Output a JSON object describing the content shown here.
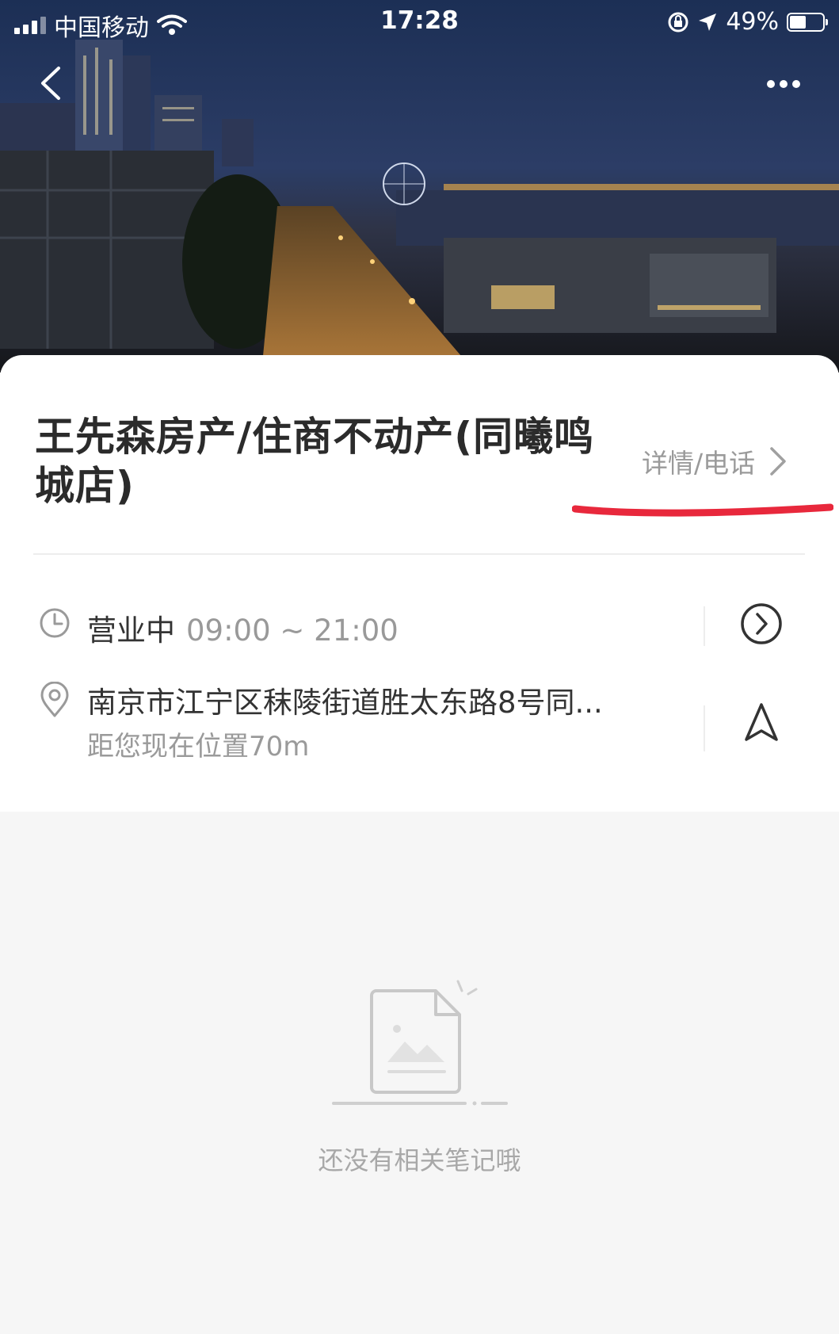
{
  "status_bar": {
    "carrier": "中国移动",
    "time": "17:28",
    "battery": "49%",
    "battery_level": 0.49,
    "icons": [
      "signal-icon",
      "wifi-icon",
      "rotation-lock-icon",
      "location-arrow-icon",
      "battery-icon"
    ]
  },
  "header": {
    "back_icon": "chevron-left-icon",
    "more_icon": "more-dots-icon"
  },
  "place": {
    "title": "王先森房产/住商不动产(同曦鸣城店)",
    "detail_link": "详情/电话",
    "hours_status": "营业中",
    "hours_time": "09:00 ~ 21:00",
    "address": "南京市江宁区秣陵街道胜太东路8号同...",
    "distance": "距您现在位置70m"
  },
  "empty_state": {
    "message": "还没有相关笔记哦"
  },
  "colors": {
    "annotation_red": "#e8283c",
    "card_bg": "#ffffff",
    "page_bg": "#f6f6f6"
  }
}
